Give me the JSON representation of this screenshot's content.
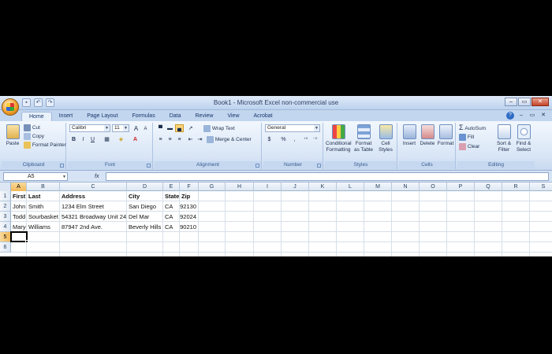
{
  "window": {
    "title": "Book1 - Microsoft Excel non-commercial use",
    "controls": [
      "–",
      "▭",
      "✕"
    ]
  },
  "tabs": [
    "Home",
    "Insert",
    "Page Layout",
    "Formulas",
    "Data",
    "Review",
    "View",
    "Acrobat"
  ],
  "active_tab": "Home",
  "ribbon": {
    "clipboard": {
      "label": "Clipboard",
      "paste": "Paste",
      "cut": "Cut",
      "copy": "Copy",
      "format_painter": "Format Painter"
    },
    "font": {
      "label": "Font",
      "font_name": "Calibri",
      "font_size": "11",
      "grow": "A",
      "shrink": "A",
      "bold": "B",
      "italic": "I",
      "underline": "U"
    },
    "alignment": {
      "label": "Alignment",
      "wrap_text": "Wrap Text",
      "merge_center": "Merge & Center"
    },
    "number": {
      "label": "Number",
      "format": "General",
      "currency": "$",
      "percent": "%",
      "comma": ","
    },
    "styles": {
      "label": "Styles",
      "conditional": "Conditional Formatting",
      "format_table": "Format as Table",
      "cell_styles": "Cell Styles"
    },
    "cells": {
      "label": "Cells",
      "insert": "Insert",
      "delete": "Delete",
      "format": "Format"
    },
    "editing": {
      "label": "Editing",
      "autosum": "AutoSum",
      "fill": "Fill",
      "clear": "Clear",
      "sort_filter": "Sort & Filter",
      "find_select": "Find & Select"
    }
  },
  "name_box": "A5",
  "fx": "fx",
  "columns": [
    "A",
    "B",
    "C",
    "D",
    "E",
    "F",
    "G",
    "H",
    "I",
    "J",
    "K",
    "L",
    "M",
    "N",
    "O",
    "P",
    "Q",
    "R",
    "S"
  ],
  "rows": [
    "1",
    "2",
    "3",
    "4",
    "5",
    "6"
  ],
  "selected_column": "A",
  "selected_row": "5",
  "cells": {
    "r1": [
      "First",
      "Last",
      "Address",
      "City",
      "State",
      "Zip"
    ],
    "r2": [
      "John",
      "Smith",
      "1234 Elm Street",
      "San Diego",
      "CA",
      "92130"
    ],
    "r3": [
      "Todd",
      "Sourbasket",
      "54321 Broadway Unit 24",
      "Del Mar",
      "CA",
      "92024"
    ],
    "r4": [
      "Mary",
      "Williams",
      "87947 2nd Ave.",
      "Beverly Hills",
      "CA",
      "90210"
    ]
  },
  "colors": {
    "accent_selected": "#f1b959",
    "ribbon_bg": "#d9e6f6",
    "office_button": "#f2a02a"
  }
}
